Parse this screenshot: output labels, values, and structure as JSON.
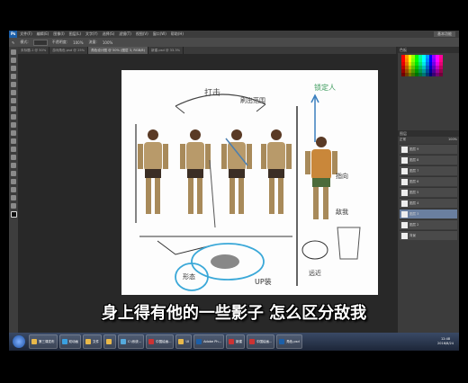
{
  "app": {
    "logo": "Ps",
    "menu": [
      "文件(F)",
      "编辑(E)",
      "图像(I)",
      "图层(L)",
      "文字(Y)",
      "选择(S)",
      "滤镜(T)",
      "视图(V)",
      "窗口(W)",
      "帮助(H)"
    ],
    "workspace": "基本功能"
  },
  "options": {
    "mode_label": "模式:",
    "mode_value": "正常",
    "opacity_label": "不透明度:",
    "opacity_value": "100%",
    "flow_label": "流量:",
    "flow_value": "100%"
  },
  "tabs": [
    {
      "label": "未标题-1 @ 50%"
    },
    {
      "label": "游戏角色.psd @ 25%"
    },
    {
      "label": "角色设计图 @ 50% (图层 3, RGB/8)"
    },
    {
      "label": "新建.psd @ 33.3%"
    }
  ],
  "panels": {
    "swatches_title": "色板",
    "layers_title": "图层",
    "blend_mode": "正常",
    "opacity": "100%",
    "layers": [
      "图层 9",
      "图层 8",
      "图层 7",
      "图层 6",
      "图层 5",
      "图层 4",
      "图层 3",
      "图层 2",
      "背景"
    ]
  },
  "drawing": {
    "annotations": [
      "打击",
      "刷出范围",
      "锁定人",
      "UP装",
      "指向",
      "敌我",
      "形态",
      "远近"
    ]
  },
  "taskbar": {
    "items": [
      {
        "label": "第三课发布",
        "color": "#e8b84a"
      },
      {
        "label": "双动画",
        "color": "#3aa0e0"
      },
      {
        "label": "文件",
        "color": "#e8b84a"
      },
      {
        "label": "",
        "color": "#e8b84a"
      },
      {
        "label": "C:\\系统...",
        "color": "#5ad"
      },
      {
        "label": "中国绘画...",
        "color": "#c33"
      },
      {
        "label": "UI",
        "color": "#e8b84a"
      },
      {
        "label": "Adobe Ph...",
        "color": "#1c5fa8"
      },
      {
        "label": "新建",
        "color": "#c33"
      },
      {
        "label": "中国绘画...",
        "color": "#c33"
      },
      {
        "label": "角色.psd",
        "color": "#1c5fa8"
      }
    ],
    "time": "12:48",
    "date": "2016/8/24"
  },
  "subtitle": "身上得有他的一些影子 怎么区分敌我"
}
